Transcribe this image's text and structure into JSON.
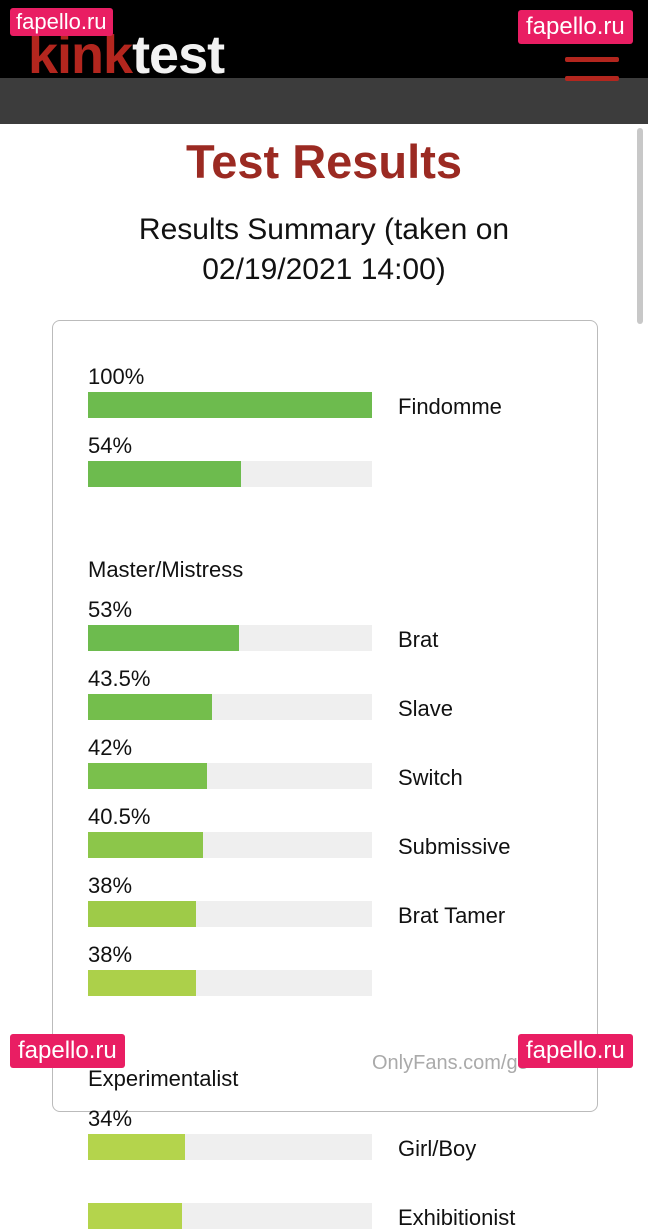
{
  "header": {
    "logo_part1": "kink",
    "logo_part2": "test",
    "menu_icon": "hamburger-icon",
    "brand_color": "#b3261e"
  },
  "watermarks": {
    "top_left": "fapello.ru",
    "top_right": "fapello.ru",
    "bottom_left": "fapello.ru",
    "bottom_right": "fapello.ru",
    "footer": "OnlyFans.com/go"
  },
  "page": {
    "title": "Test Results",
    "summary_line1": "Results Summary (taken on",
    "summary_line2": "02/19/2021 14:00)"
  },
  "results": [
    {
      "pct_label": "100%",
      "value": 100,
      "name": "Findomme",
      "label_pos": "side",
      "color": "#6dbb4e"
    },
    {
      "pct_label": "54%",
      "value": 54,
      "name": "Master/Mistress",
      "label_pos": "below",
      "color": "#6dbb4e"
    },
    {
      "pct_label": "53%",
      "value": 53,
      "name": "Brat",
      "label_pos": "side",
      "color": "#6dbb4e"
    },
    {
      "pct_label": "43.5%",
      "value": 43.5,
      "name": "Slave",
      "label_pos": "side",
      "color": "#74be4c"
    },
    {
      "pct_label": "42%",
      "value": 42,
      "name": "Switch",
      "label_pos": "side",
      "color": "#7ac04c"
    },
    {
      "pct_label": "40.5%",
      "value": 40.5,
      "name": "Submissive",
      "label_pos": "side",
      "color": "#8cc64a"
    },
    {
      "pct_label": "38%",
      "value": 38,
      "name": "Brat Tamer",
      "label_pos": "side",
      "color": "#9ecb48"
    },
    {
      "pct_label": "38%",
      "value": 38,
      "name": "Experimentalist",
      "label_pos": "below",
      "color": "#acd04a"
    },
    {
      "pct_label": "34%",
      "value": 34,
      "name": "Girl/Boy",
      "label_pos": "side",
      "color": "#b4d44c"
    },
    {
      "pct_label": "",
      "value": 33,
      "name": "Exhibitionist",
      "label_pos": "side",
      "color": "#b4d44c"
    }
  ]
}
